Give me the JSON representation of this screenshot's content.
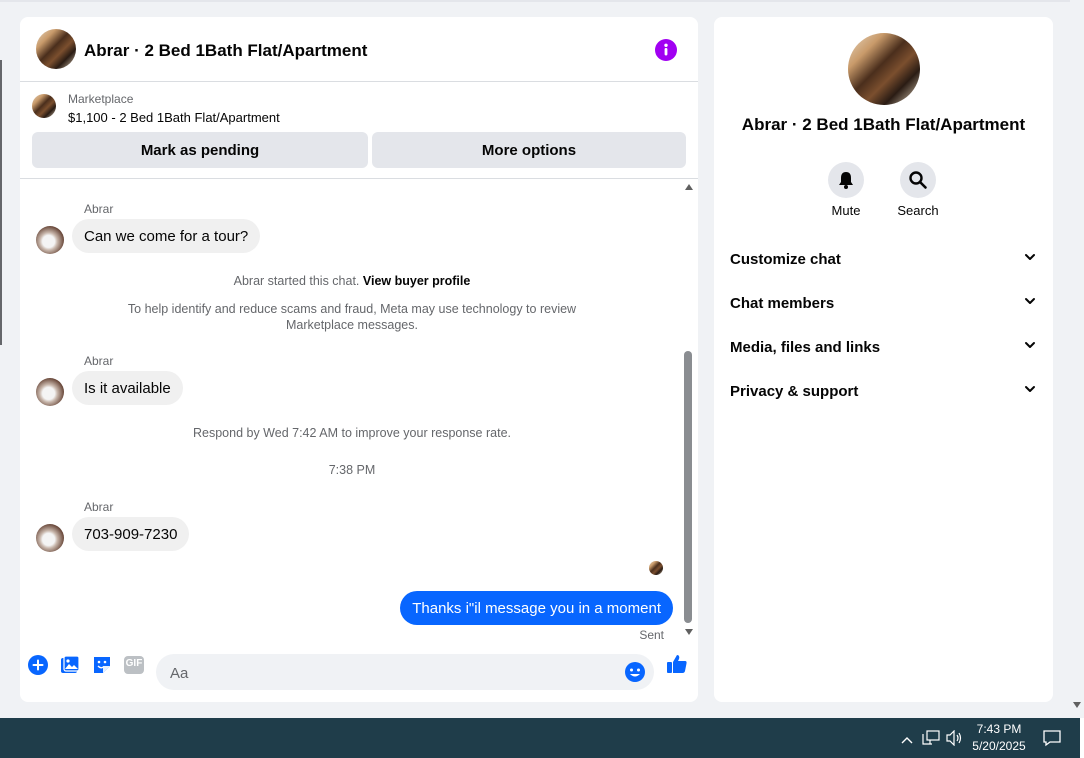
{
  "header": {
    "title": "Abrar · 2 Bed 1Bath Flat/Apartment"
  },
  "marketplace": {
    "label": "Marketplace",
    "item": "$1,100 - 2 Bed 1Bath Flat/Apartment",
    "pending_button": "Mark as pending",
    "more_button": "More options"
  },
  "messages": {
    "m1_sender": "Abrar",
    "m1_text": "Can we come for a tour?",
    "started_text": "Abrar started this chat.",
    "view_profile": "View buyer profile",
    "scam_notice": "To help identify and reduce scams and fraud, Meta may use technology to review Marketplace messages.",
    "m2_sender": "Abrar",
    "m2_text": "Is it available",
    "respond_notice": "Respond by Wed 7:42 AM to improve your response rate.",
    "timestamp": "7:38 PM",
    "m3_sender": "Abrar",
    "m3_text": "703-909-7230",
    "mine_text": "Thanks i\"il message you in a moment",
    "sent_status": "Sent"
  },
  "composer": {
    "placeholder": "Aa",
    "gif_label": "GIF"
  },
  "side": {
    "title": "Abrar · 2 Bed 1Bath Flat/Apartment",
    "mute_label": "Mute",
    "search_label": "Search",
    "sections": [
      "Customize chat",
      "Chat members",
      "Media, files and links",
      "Privacy & support"
    ]
  },
  "taskbar": {
    "time": "7:43 PM",
    "date": "5/20/2025"
  },
  "colors": {
    "accent": "#0866ff",
    "info": "#a100f2",
    "taskbar": "#1f3d4a"
  }
}
